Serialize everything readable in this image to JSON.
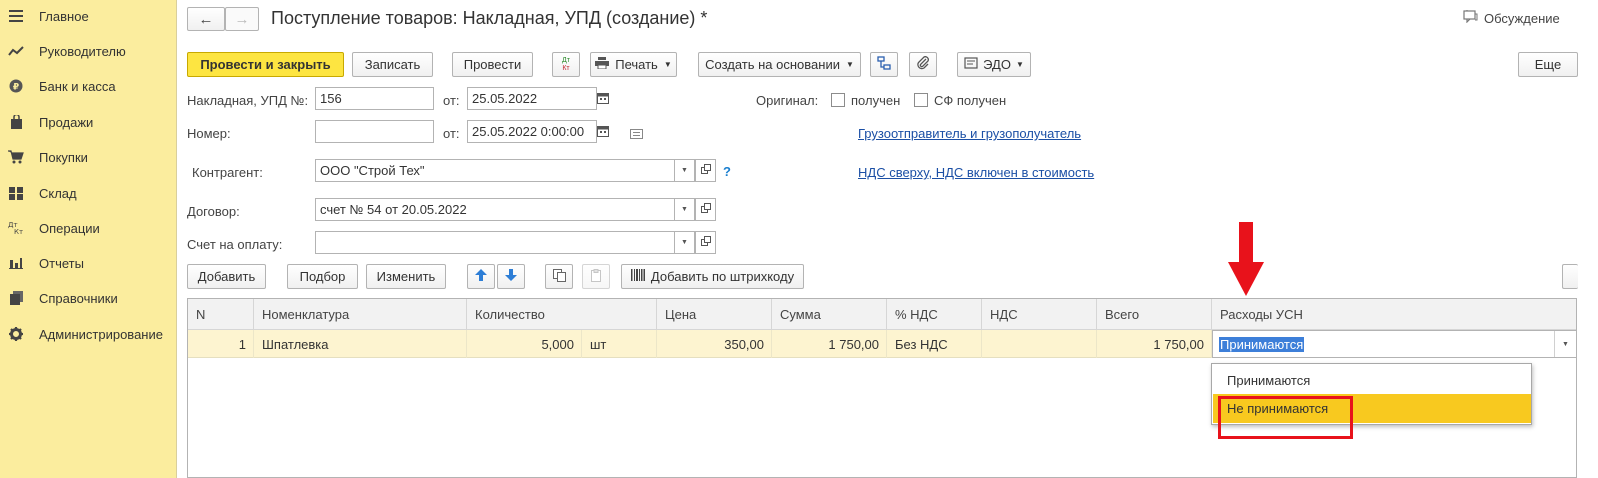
{
  "sidebar": {
    "items": [
      {
        "label": "Главное",
        "icon": "menu-icon"
      },
      {
        "label": "Руководителю",
        "icon": "trend-icon"
      },
      {
        "label": "Банк и касса",
        "icon": "coin-icon"
      },
      {
        "label": "Продажи",
        "icon": "bag-icon"
      },
      {
        "label": "Покупки",
        "icon": "cart-icon"
      },
      {
        "label": "Склад",
        "icon": "warehouse-icon"
      },
      {
        "label": "Операции",
        "icon": "dt-kt-icon"
      },
      {
        "label": "Отчеты",
        "icon": "bar-chart-icon"
      },
      {
        "label": "Справочники",
        "icon": "books-icon"
      },
      {
        "label": "Администрирование",
        "icon": "gear-icon"
      }
    ]
  },
  "header": {
    "title": "Поступление товаров: Накладная, УПД (создание) *",
    "discussion": "Обсуждение",
    "back_glyph": "←",
    "forward_glyph": "→"
  },
  "toolbar": {
    "post_close": "Провести и закрыть",
    "save": "Записать",
    "post": "Провести",
    "dtkt_top": "Дт",
    "dtkt_bottom": "Кт",
    "print": "Печать",
    "create_based": "Создать на основании",
    "edo": "ЭДО",
    "more": "Еще"
  },
  "form": {
    "invoice_label": "Накладная, УПД №:",
    "invoice_number": "156",
    "from_label": "от:",
    "invoice_date": "25.05.2022",
    "original_label": "Оригинал:",
    "received_label": "получен",
    "sf_received_label": "СФ получен",
    "number_label": "Номер:",
    "number_value": "",
    "number_date": "25.05.2022  0:00:00",
    "shipper_link": "Грузоотправитель и грузополучатель",
    "counterparty_label": "Контрагент:",
    "counterparty_value": "ООО \"Строй Тех\"",
    "help": "?",
    "vat_link": "НДС сверху, НДС включен в стоимость",
    "contract_label": "Договор:",
    "contract_value": "счет № 54 от 20.05.2022",
    "payment_label": "Счет на оплату:",
    "payment_value": ""
  },
  "table_toolbar": {
    "add": "Добавить",
    "select": "Подбор",
    "change": "Изменить",
    "barcode": "Добавить по штрихкоду"
  },
  "table": {
    "columns": [
      "N",
      "Номенклатура",
      "Количество",
      "Цена",
      "Сумма",
      "% НДС",
      "НДС",
      "Всего",
      "Расходы УСН"
    ],
    "rows": [
      {
        "n": "1",
        "item": "Шпатлевка",
        "qty": "5,000",
        "unit": "шт",
        "price": "350,00",
        "sum": "1 750,00",
        "vat_rate": "Без НДС",
        "vat": "",
        "total": "1 750,00",
        "usn": "Принимаются"
      }
    ]
  },
  "dropdown": {
    "options": [
      "Принимаются",
      "Не принимаются"
    ],
    "highlighted": "Не принимаются"
  },
  "colors": {
    "sidebar_bg": "#fbed9e",
    "primary_button": "#fde541",
    "row_highlight": "#fdf4d0",
    "dropdown_highlight": "#f8c91f",
    "annotation_red": "#e8121b",
    "link": "#1b4fa5"
  }
}
